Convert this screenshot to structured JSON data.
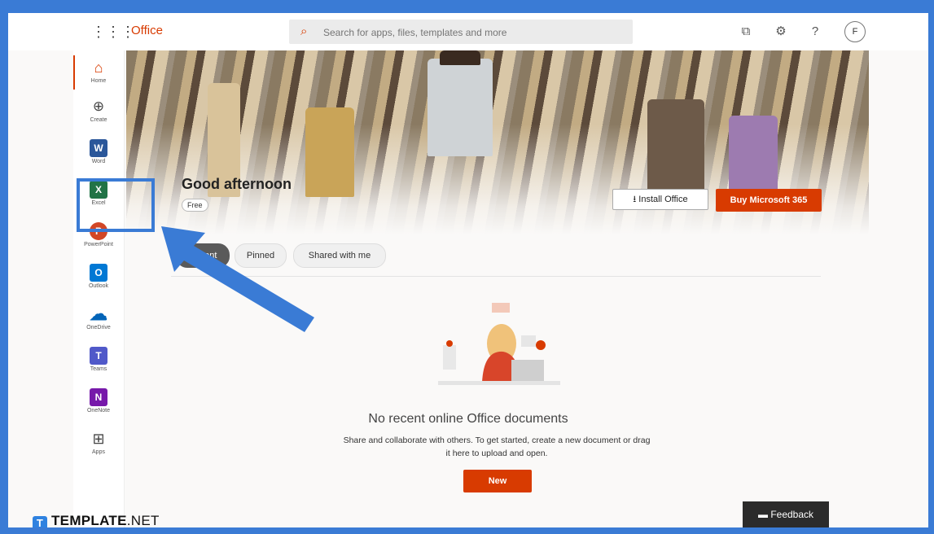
{
  "app": {
    "brand": "Office"
  },
  "search": {
    "placeholder": "Search for apps, files, templates and more"
  },
  "topbar": {
    "avatar_initial": "F",
    "icons": [
      "waffle-icon",
      "copilot-icon",
      "gear-icon",
      "help-icon"
    ]
  },
  "rail": {
    "items": [
      {
        "label": "Home",
        "icon": "home-icon",
        "color": "#d83b01"
      },
      {
        "label": "Create",
        "icon": "plus-circle-icon",
        "color": "#444444"
      },
      {
        "label": "Word",
        "icon": "word-icon",
        "color": "#2b579a",
        "glyph": "W"
      },
      {
        "label": "Excel",
        "icon": "excel-icon",
        "color": "#217346",
        "glyph": "X"
      },
      {
        "label": "PowerPoint",
        "icon": "powerpoint-icon",
        "color": "#d24726",
        "glyph": "P"
      },
      {
        "label": "Outlook",
        "icon": "outlook-icon",
        "color": "#0078d4",
        "glyph": "O"
      },
      {
        "label": "OneDrive",
        "icon": "onedrive-icon",
        "color": "#0364b8"
      },
      {
        "label": "Teams",
        "icon": "teams-icon",
        "color": "#5059c9",
        "glyph": "T"
      },
      {
        "label": "OneNote",
        "icon": "onenote-icon",
        "color": "#7719aa",
        "glyph": "N"
      },
      {
        "label": "Apps",
        "icon": "apps-icon",
        "color": "#444444"
      }
    ]
  },
  "hero": {
    "greeting": "Good afternoon",
    "plan_badge": "Free",
    "install_label": "Install Office",
    "buy_label": "Buy Microsoft 365"
  },
  "tabs": [
    {
      "label": "Recent",
      "active": true
    },
    {
      "label": "Pinned",
      "active": false
    },
    {
      "label": "Shared with me",
      "active": false
    }
  ],
  "empty_state": {
    "title": "No recent online Office documents",
    "body": "Share and collaborate with others. To get started, create a new document or drag it here to upload and open.",
    "new_label": "New"
  },
  "feedback_label": "Feedback",
  "watermark": {
    "brand": "TEMPLATE",
    "suffix": ".NET"
  },
  "colors": {
    "accent": "#d83b01",
    "annotation": "#3a7bd5"
  }
}
